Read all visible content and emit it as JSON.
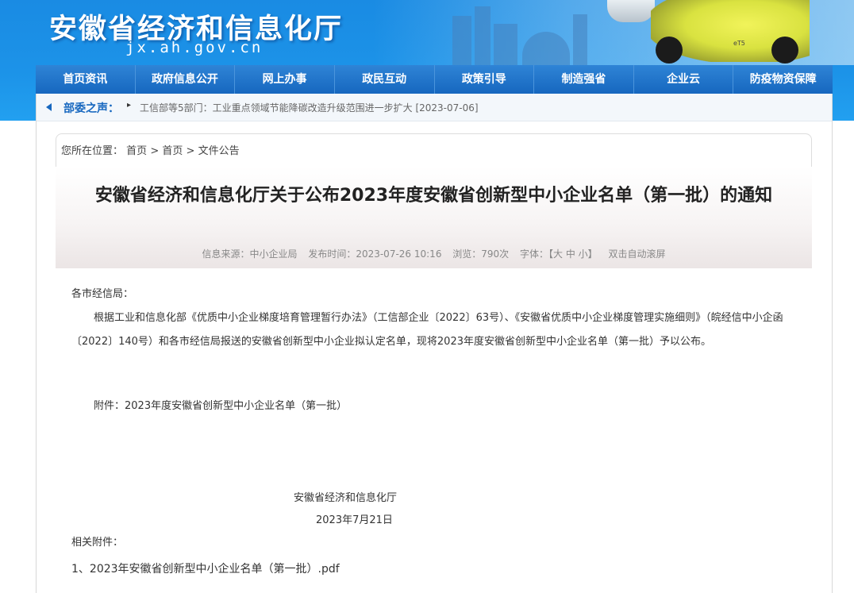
{
  "header": {
    "site_title": "安徽省经济和信息化厅",
    "site_domain": "jx.ah.gov.cn",
    "car_badge": "eT5"
  },
  "nav": {
    "items": [
      "首页资讯",
      "政府信息公开",
      "网上办事",
      "政民互动",
      "政策引导",
      "制造强省",
      "企业云",
      "防疫物资保障"
    ]
  },
  "notice": {
    "label": "部委之声：",
    "bullet": "▸",
    "text": "工信部等5部门：工业重点领域节能降碳改造升级范围进一步扩大 [2023-07-06]"
  },
  "breadcrumb": {
    "prefix": "您所在位置：",
    "items": [
      "首页",
      "首页",
      "文件公告"
    ],
    "separator": ">"
  },
  "article": {
    "title": "安徽省经济和信息化厅关于公布2023年度安徽省创新型中小企业名单（第一批）的通知",
    "meta": {
      "source": "信息来源：中小企业局",
      "time": "发布时间：2023-07-26 10:16",
      "views": "浏览：790次",
      "font_label": "字体：",
      "font_sizes": "【大 中 小】",
      "autoscroll": "双击自动滚屏"
    },
    "salutation": "各市经信局：",
    "body_para": "根据工业和信息化部《优质中小企业梯度培育管理暂行办法》（工信部企业〔2022〕63号）、《安徽省优质中小企业梯度管理实施细则》（皖经信中小企函〔2022〕140号）和各市经信局报送的安徽省创新型中小企业拟认定名单，现将2023年度安徽省创新型中小企业名单（第一批）予以公布。",
    "attachment_line": "附件：2023年度安徽省创新型中小企业名单（第一批）",
    "signature_org": "安徽省经济和信息化厅",
    "signature_date": "2023年7月21日",
    "related_label": "相关附件：",
    "related_file": "1、2023年安徽省创新型中小企业名单（第一批）.pdf"
  },
  "colors": {
    "header_blue": "#1c93e8",
    "nav_blue": "#1667bf",
    "accent": "#1667bf"
  }
}
